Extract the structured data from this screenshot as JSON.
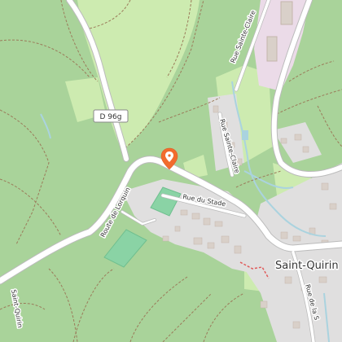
{
  "map": {
    "place_label": "Saint-Quirin",
    "road_shield": "D 96g",
    "streets": [
      {
        "key": "route_lorquin",
        "label": "Route de Lorquin"
      },
      {
        "key": "rue_stade",
        "label": "Rue du Stade"
      },
      {
        "key": "rue_sainte_claire_1",
        "label": "Rue Sainte-Claire"
      },
      {
        "key": "rue_sainte_claire_2",
        "label": "Rue Sainte-Claire"
      },
      {
        "key": "rue_de_la_s",
        "label": "Rue de la S"
      }
    ],
    "other_labels": {
      "left_edge": "Saint-Quirin"
    },
    "marker": {
      "icon": "map-pin-icon",
      "color": "#f26b2d"
    },
    "colors": {
      "forest": "#a9d39a",
      "meadow": "#cdebb0",
      "residential": "#e0dfdf",
      "pitch": "#8ad3a5",
      "industrial": "#ebdbe8",
      "water": "#aad3df",
      "road": "#ffffff",
      "path": "#9b7b5a"
    }
  }
}
